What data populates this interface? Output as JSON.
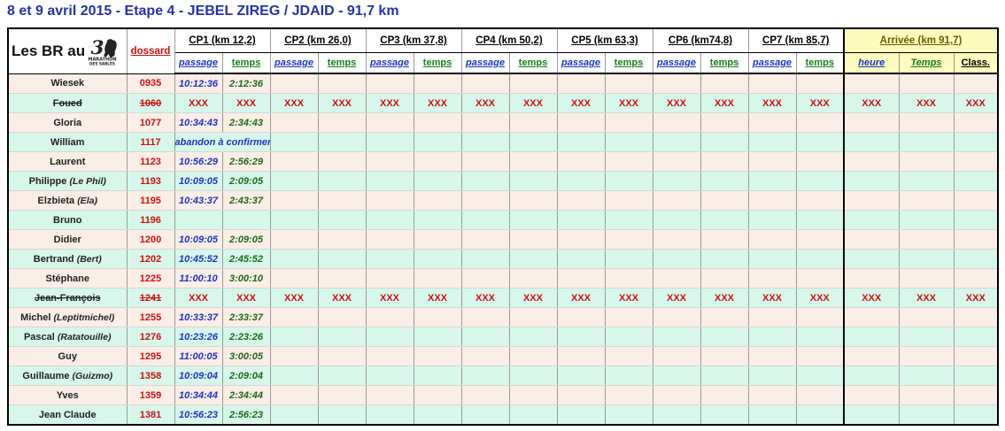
{
  "title": "8 et 9 avril 2015 - Etape 4 - JEBEL ZIREG / JDAID - 91,7 km",
  "header": {
    "br_label": "Les BR au",
    "logo_text": "MARATHON DES SABLES",
    "dossard_label": "dossard",
    "checkpoints": [
      "CP1 (km 12,2)",
      "CP2 (km 26,0)",
      "CP3 (km 37,8)",
      "CP4 (km 50,2)",
      "CP5 (km 63,3)",
      "CP6 (km74,8)",
      "CP7 (km 85,7)"
    ],
    "arrival": "Arrivée (km 91,7)",
    "sub_pass": "passage",
    "sub_time": "temps",
    "sub_heure": "heure",
    "sub_temps": "Temps",
    "sub_class": "Class."
  },
  "abandon_text": "abandon à confirmer",
  "xxx": "XXX",
  "rows": [
    {
      "name": "Wiesek",
      "nick": "",
      "dossard": "0935",
      "pass": "10:12:36",
      "time": "2:12:36",
      "status": "ok"
    },
    {
      "name": "Foued",
      "nick": "",
      "dossard": "1060",
      "pass": "",
      "time": "",
      "status": "out"
    },
    {
      "name": "Gloria",
      "nick": "",
      "dossard": "1077",
      "pass": "10:34:43",
      "time": "2:34:43",
      "status": "ok"
    },
    {
      "name": "William",
      "nick": "",
      "dossard": "1117",
      "pass": "",
      "time": "",
      "status": "abandon"
    },
    {
      "name": "Laurent",
      "nick": "",
      "dossard": "1123",
      "pass": "10:56:29",
      "time": "2:56:29",
      "status": "ok"
    },
    {
      "name": "Philippe",
      "nick": "(Le Phil)",
      "dossard": "1193",
      "pass": "10:09:05",
      "time": "2:09:05",
      "status": "ok"
    },
    {
      "name": "Elzbieta",
      "nick": "(Ela)",
      "dossard": "1195",
      "pass": "10:43:37",
      "time": "2:43:37",
      "status": "ok"
    },
    {
      "name": "Bruno",
      "nick": "",
      "dossard": "1196",
      "pass": "",
      "time": "",
      "status": "ok"
    },
    {
      "name": "Didier",
      "nick": "",
      "dossard": "1200",
      "pass": "10:09:05",
      "time": "2:09:05",
      "status": "ok"
    },
    {
      "name": "Bertrand",
      "nick": "(Bert)",
      "dossard": "1202",
      "pass": "10:45:52",
      "time": "2:45:52",
      "status": "ok"
    },
    {
      "name": "Stéphane",
      "nick": "",
      "dossard": "1225",
      "pass": "11:00:10",
      "time": "3:00:10",
      "status": "ok"
    },
    {
      "name": "Jean-François",
      "nick": "",
      "dossard": "1241",
      "pass": "",
      "time": "",
      "status": "out"
    },
    {
      "name": "Michel",
      "nick": "(Leptitmichel)",
      "dossard": "1255",
      "pass": "10:33:37",
      "time": "2:33:37",
      "status": "ok"
    },
    {
      "name": "Pascal",
      "nick": "(Ratatouille)",
      "dossard": "1276",
      "pass": "10:23:26",
      "time": "2:23:26",
      "status": "ok"
    },
    {
      "name": "Guy",
      "nick": "",
      "dossard": "1295",
      "pass": "11:00:05",
      "time": "3:00:05",
      "status": "ok"
    },
    {
      "name": "Guillaume",
      "nick": "(Guizmo)",
      "dossard": "1358",
      "pass": "10:09:04",
      "time": "2:09:04",
      "status": "ok"
    },
    {
      "name": "Yves",
      "nick": "",
      "dossard": "1359",
      "pass": "10:34:44",
      "time": "2:34:44",
      "status": "ok"
    },
    {
      "name": "Jean Claude",
      "nick": "",
      "dossard": "1381",
      "pass": "10:56:23",
      "time": "2:56:23",
      "status": "ok"
    }
  ]
}
